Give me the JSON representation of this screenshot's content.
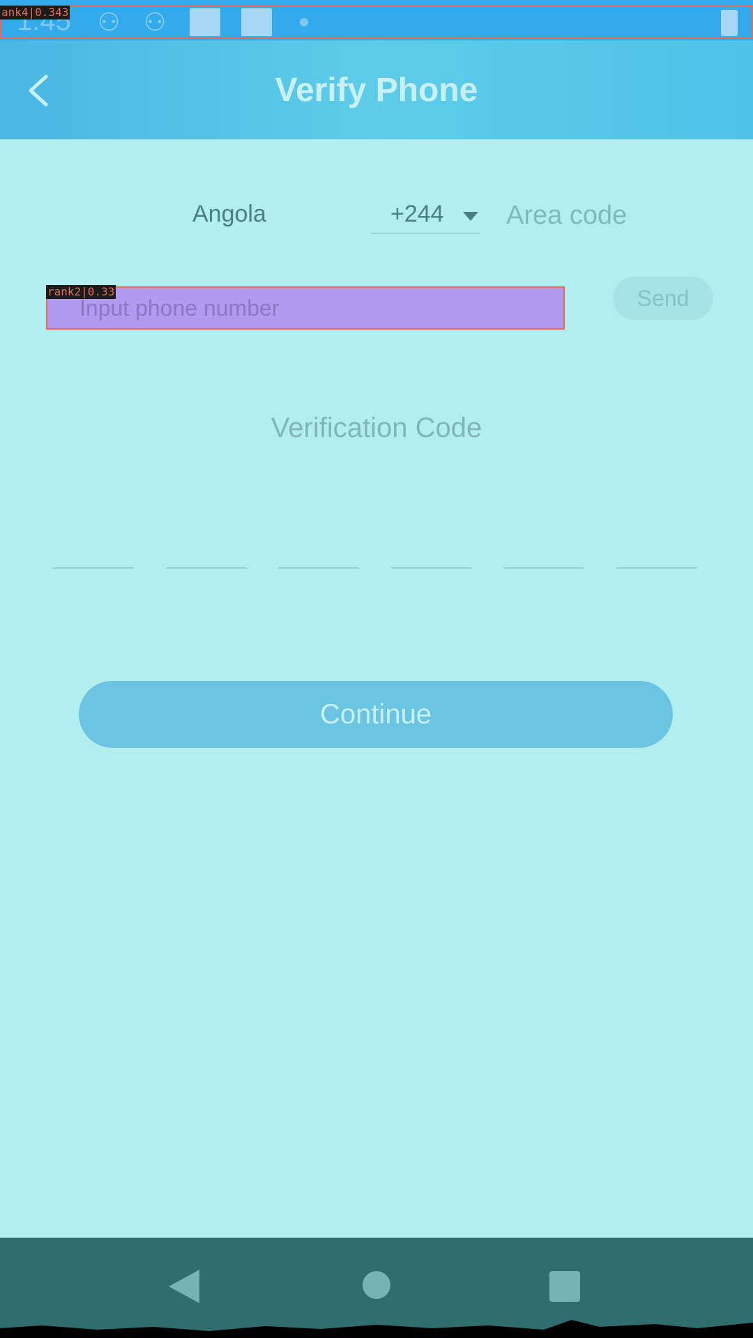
{
  "status_bar": {
    "time": "1:45",
    "overlay_label": "ank4|0.343"
  },
  "header": {
    "title": "Verify Phone",
    "back_icon": "chevron-left-icon"
  },
  "area": {
    "country": "Angola",
    "code": "+244",
    "label": "Area code"
  },
  "phone": {
    "placeholder": "Input phone number",
    "value": "",
    "overlay_label": "rank2|0.33"
  },
  "send": {
    "label": "Send"
  },
  "verification": {
    "title": "Verification Code",
    "slots": [
      "",
      "",
      "",
      "",
      "",
      ""
    ]
  },
  "continue": {
    "label": "Continue"
  },
  "nav": {
    "icons": [
      "back-triangle-icon",
      "home-circle-icon",
      "recents-square-icon"
    ]
  },
  "colors": {
    "header": "#4ec3e8",
    "background": "#b3eeef",
    "nav_bar": "#306d6e",
    "continue": "#6cc4e3",
    "highlight": "#b09bee"
  }
}
